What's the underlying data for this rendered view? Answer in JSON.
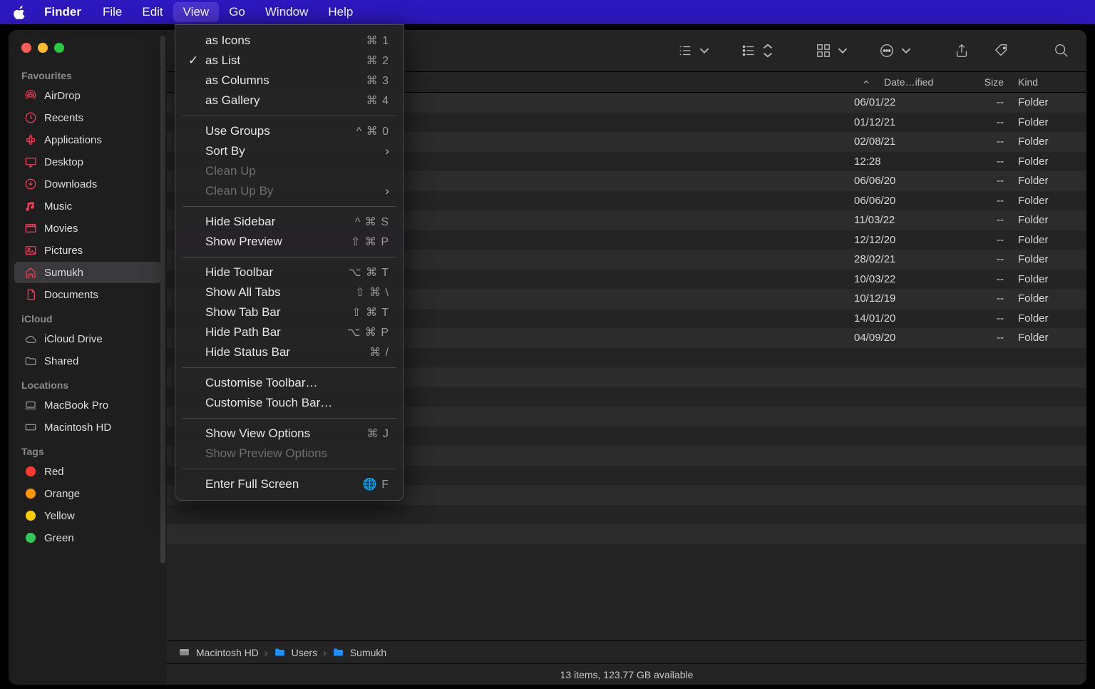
{
  "menubar": {
    "app": "Finder",
    "items": [
      "File",
      "Edit",
      "View",
      "Go",
      "Window",
      "Help"
    ],
    "open_index": 2
  },
  "dropdown": {
    "groups": [
      [
        {
          "label": "as Icons",
          "shortcut": "⌘ 1"
        },
        {
          "label": "as List",
          "shortcut": "⌘ 2",
          "checked": true
        },
        {
          "label": "as Columns",
          "shortcut": "⌘ 3"
        },
        {
          "label": "as Gallery",
          "shortcut": "⌘ 4"
        }
      ],
      [
        {
          "label": "Use Groups",
          "shortcut": "^ ⌘ 0"
        },
        {
          "label": "Sort By",
          "submenu": true
        },
        {
          "label": "Clean Up",
          "disabled": true
        },
        {
          "label": "Clean Up By",
          "disabled": true,
          "submenu": true
        }
      ],
      [
        {
          "label": "Hide Sidebar",
          "shortcut": "^ ⌘ S"
        },
        {
          "label": "Show Preview",
          "shortcut": "⇧ ⌘ P",
          "highlight": true
        }
      ],
      [
        {
          "label": "Hide Toolbar",
          "shortcut": "⌥ ⌘ T"
        },
        {
          "label": "Show All Tabs",
          "shortcut": "⇧ ⌘ \\"
        },
        {
          "label": "Show Tab Bar",
          "shortcut": "⇧ ⌘ T"
        },
        {
          "label": "Hide Path Bar",
          "shortcut": "⌥ ⌘ P"
        },
        {
          "label": "Hide Status Bar",
          "shortcut": "⌘ /"
        }
      ],
      [
        {
          "label": "Customise Toolbar…"
        },
        {
          "label": "Customise Touch Bar…"
        }
      ],
      [
        {
          "label": "Show View Options",
          "shortcut": "⌘ J"
        },
        {
          "label": "Show Preview Options",
          "disabled": true
        }
      ],
      [
        {
          "label": "Enter Full Screen",
          "shortcut": "🌐 F"
        }
      ]
    ]
  },
  "sidebar": {
    "sections": [
      {
        "title": "Favourites",
        "items": [
          {
            "icon": "airdrop",
            "label": "AirDrop"
          },
          {
            "icon": "clock",
            "label": "Recents"
          },
          {
            "icon": "apps",
            "label": "Applications"
          },
          {
            "icon": "desktop",
            "label": "Desktop"
          },
          {
            "icon": "downloads",
            "label": "Downloads"
          },
          {
            "icon": "music",
            "label": "Music"
          },
          {
            "icon": "movies",
            "label": "Movies"
          },
          {
            "icon": "pictures",
            "label": "Pictures"
          },
          {
            "icon": "home",
            "label": "Sumukh",
            "selected": true
          },
          {
            "icon": "documents",
            "label": "Documents"
          }
        ]
      },
      {
        "title": "iCloud",
        "items": [
          {
            "icon": "cloud",
            "label": "iCloud Drive"
          },
          {
            "icon": "shared",
            "label": "Shared"
          }
        ]
      },
      {
        "title": "Locations",
        "items": [
          {
            "icon": "laptop",
            "label": "MacBook Pro"
          },
          {
            "icon": "disk",
            "label": "Macintosh HD"
          }
        ]
      },
      {
        "title": "Tags",
        "items": [
          {
            "icon": "tag",
            "color": "#ff3b30",
            "label": "Red"
          },
          {
            "icon": "tag",
            "color": "#ff9500",
            "label": "Orange"
          },
          {
            "icon": "tag",
            "color": "#ffcc00",
            "label": "Yellow"
          },
          {
            "icon": "tag",
            "color": "#34c759",
            "label": "Green"
          }
        ]
      }
    ]
  },
  "columns": {
    "name": "Name",
    "date": "Date…ified",
    "size": "Size",
    "kind": "Kind"
  },
  "rows": [
    {
      "date": "06/01/22",
      "size": "--",
      "kind": "Folder"
    },
    {
      "date": "01/12/21",
      "size": "--",
      "kind": "Folder"
    },
    {
      "date": "02/08/21",
      "size": "--",
      "kind": "Folder"
    },
    {
      "date": "12:28",
      "size": "--",
      "kind": "Folder"
    },
    {
      "date": "06/06/20",
      "size": "--",
      "kind": "Folder"
    },
    {
      "date": "06/06/20",
      "size": "--",
      "kind": "Folder"
    },
    {
      "date": "11/03/22",
      "size": "--",
      "kind": "Folder"
    },
    {
      "date": "12/12/20",
      "size": "--",
      "kind": "Folder"
    },
    {
      "date": "28/02/21",
      "size": "--",
      "kind": "Folder"
    },
    {
      "date": "10/03/22",
      "size": "--",
      "kind": "Folder"
    },
    {
      "date": "10/12/19",
      "size": "--",
      "kind": "Folder"
    },
    {
      "date": "14/01/20",
      "size": "--",
      "kind": "Folder"
    },
    {
      "date": "04/09/20",
      "size": "--",
      "kind": "Folder"
    }
  ],
  "pathbar": [
    "Macintosh HD",
    "Users",
    "Sumukh"
  ],
  "statusbar": "13 items, 123.77 GB available"
}
